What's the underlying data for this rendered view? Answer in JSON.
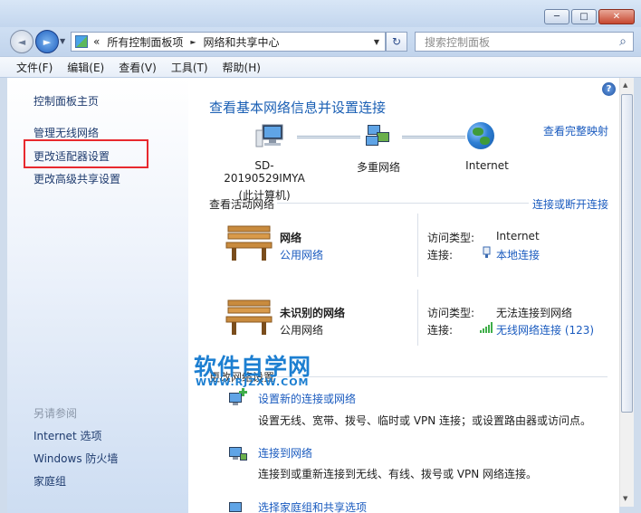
{
  "window": {
    "minimize_glyph": "─",
    "maximize_glyph": "□",
    "close_glyph": "✕"
  },
  "address": {
    "back_glyph": "◄",
    "forward_glyph": "►",
    "chevrons": "«",
    "crumbs": [
      "所有控制面板项",
      "网络和共享中心"
    ],
    "sep_glyph": "►",
    "dropdown_glyph": "▼",
    "refresh_glyph": "↻",
    "search_placeholder": "搜索控制面板",
    "search_glyph": "⌕"
  },
  "menu": [
    "文件(F)",
    "编辑(E)",
    "查看(V)",
    "工具(T)",
    "帮助(H)"
  ],
  "sidebar": {
    "home": "控制面板主页",
    "links": [
      "管理无线网络",
      "更改适配器设置",
      "更改高级共享设置"
    ],
    "see_also_title": "另请参阅",
    "see_also": [
      "Internet 选项",
      "Windows 防火墙",
      "家庭组"
    ]
  },
  "main": {
    "help_glyph": "?",
    "title": "查看基本网络信息并设置连接",
    "view_full_map": "查看完整映射",
    "map": {
      "computer_name": "SD-20190529IMYA",
      "computer_sub": "(此计算机)",
      "middle": "多重网络",
      "internet": "Internet"
    },
    "active_title": "查看活动网络",
    "connect_disconnect": "连接或断开连接",
    "networks": [
      {
        "name": "网络",
        "type": "公用网络",
        "access_label": "访问类型:",
        "access": "Internet",
        "conn_label": "连接:",
        "conn": "本地连接"
      },
      {
        "name": "未识别的网络",
        "type": "公用网络",
        "access_label": "访问类型:",
        "access": "无法连接到网络",
        "conn_label": "连接:",
        "conn": "无线网络连接 (123)"
      }
    ],
    "change_title": "更改网络设置",
    "tasks": [
      {
        "title": "设置新的连接或网络",
        "desc": "设置无线、宽带、拨号、临时或 VPN 连接；或设置路由器或访问点。"
      },
      {
        "title": "连接到网络",
        "desc": "连接到或重新连接到无线、有线、拨号或 VPN 网络连接。"
      },
      {
        "title": "选择家庭组和共享选项",
        "desc": ""
      }
    ]
  },
  "watermark": {
    "line1": "软件自学网",
    "line2": "WWW.RJZXW.COM"
  },
  "colors": {
    "link": "#1a5bbf",
    "title": "#1a5fb4",
    "highlight": "#e8292e",
    "watermark": "#1d7fd1"
  }
}
